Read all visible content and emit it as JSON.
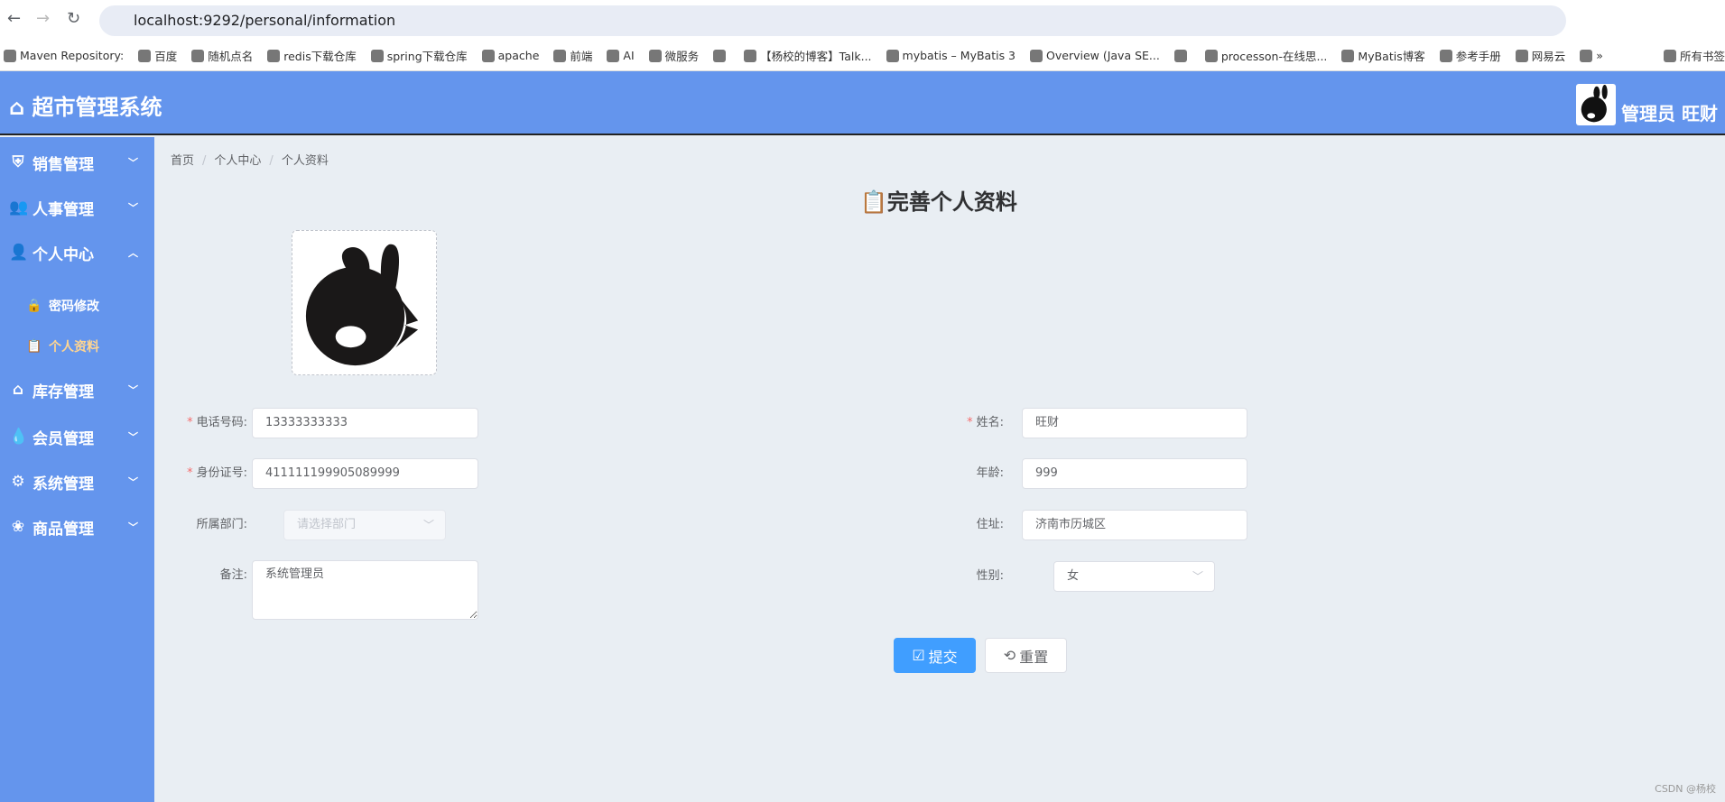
{
  "browser": {
    "url": "localhost:9292/personal/information",
    "bookmarks": [
      "Maven Repository:",
      "百度",
      "随机点名",
      "redis下载仓库",
      "spring下载仓库",
      "apache",
      "前端",
      "AI",
      "微服务",
      "",
      "【杨校的博客】Talk...",
      "mybatis – MyBatis 3",
      "Overview (Java SE...",
      "",
      "processon-在线思...",
      "MyBatis博客",
      "参考手册",
      "网易云",
      "»",
      "所有书签"
    ]
  },
  "header": {
    "title": "超市管理系统",
    "user": "管理员 旺财"
  },
  "sidebar": {
    "items": [
      {
        "label": "销售管理",
        "icon": "shield-icon"
      },
      {
        "label": "人事管理",
        "icon": "users-icon"
      },
      {
        "label": "个人中心",
        "icon": "user-icon",
        "expanded": true
      },
      {
        "label": "库存管理",
        "icon": "warehouse-icon"
      },
      {
        "label": "会员管理",
        "icon": "drop-icon"
      },
      {
        "label": "系统管理",
        "icon": "gear-icon"
      },
      {
        "label": "商品管理",
        "icon": "goods-icon"
      }
    ],
    "subitems": [
      {
        "label": "密码修改",
        "icon": "lock-icon"
      },
      {
        "label": "个人资料",
        "icon": "document-icon",
        "active": true
      }
    ]
  },
  "breadcrumb": [
    "首页",
    "个人中心",
    "个人资料"
  ],
  "form": {
    "title": "完善个人资料",
    "phone": {
      "label": "电话号码:",
      "value": "13333333333"
    },
    "idcard": {
      "label": "身份证号:",
      "value": "411111199905089999"
    },
    "dept": {
      "label": "所属部门:",
      "placeholder": "请选择部门"
    },
    "remark": {
      "label": "备注:",
      "value": "系统管理员"
    },
    "name": {
      "label": "姓名:",
      "value": "旺财"
    },
    "age": {
      "label": "年龄:",
      "value": "999"
    },
    "address": {
      "label": "住址:",
      "value": "济南市历城区"
    },
    "gender": {
      "label": "性别:",
      "value": "女"
    },
    "submit": "提交",
    "reset": "重置"
  },
  "watermark": "CSDN @杨校",
  "colors": {
    "primary": "#6495ed",
    "button": "#409eff",
    "active": "#ffd591"
  }
}
